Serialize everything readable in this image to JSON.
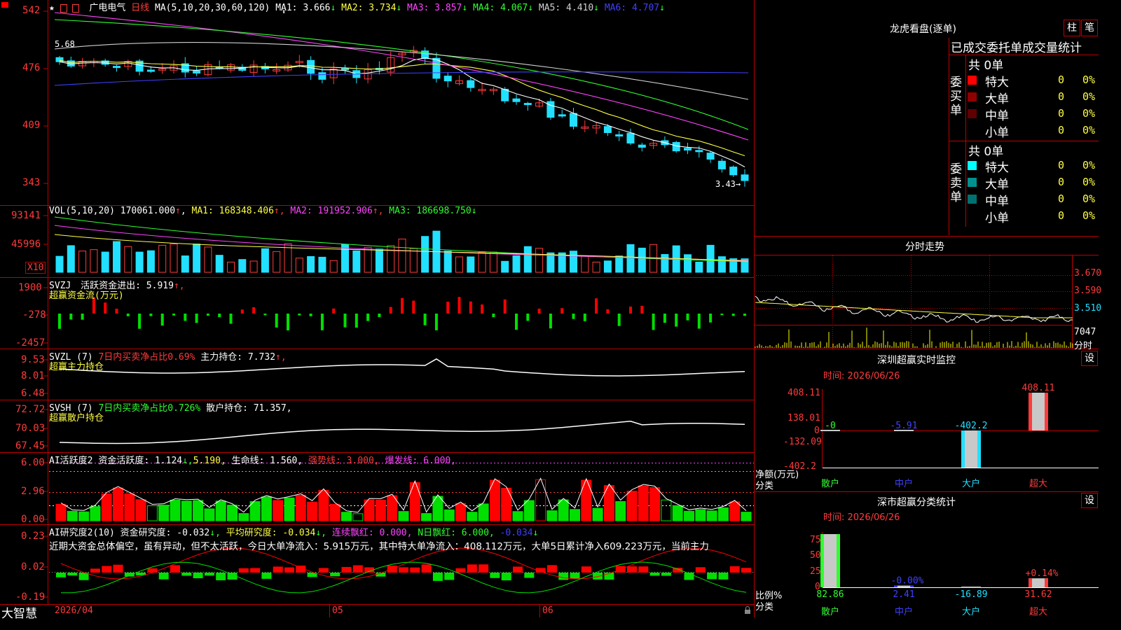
{
  "header": {
    "star_icon": "star-icon",
    "flag_icons": [
      "flag-icon",
      "flag-icon"
    ],
    "stock_name": "广电电气",
    "period": "日线",
    "ma_params": "MA(5,10,20,30,60,120)",
    "ma": [
      {
        "label": "MA1:",
        "value": "3.666",
        "arrow": "↓",
        "color": "#ffffff"
      },
      {
        "label": "MA2:",
        "value": "3.734",
        "arrow": "↓",
        "color": "#ffff44"
      },
      {
        "label": "MA3:",
        "value": "3.857",
        "arrow": "↓",
        "color": "#ff44ff"
      },
      {
        "label": "MA4:",
        "value": "4.067",
        "arrow": "↓",
        "color": "#30ff30"
      },
      {
        "label": "MA5:",
        "value": "4.410",
        "arrow": "↓",
        "color": "#d0d0d0"
      },
      {
        "label": "MA6:",
        "value": "4.707",
        "arrow": "↓",
        "color": "#4040ff"
      }
    ]
  },
  "price_axis": [
    "542",
    "476",
    "409",
    "343"
  ],
  "price_high_label": "5.68",
  "price_low_label": "3.43",
  "vol": {
    "title": "VOL(5,10,20)",
    "value": "170061.000",
    "ma": [
      {
        "label": "MA1:",
        "value": "168348.406",
        "arrow": "↑",
        "color": "#ffff44"
      },
      {
        "label": "MA2:",
        "value": "191952.906",
        "arrow": "↑",
        "color": "#ff44ff"
      },
      {
        "label": "MA3:",
        "value": "186698.750",
        "arrow": "↓",
        "color": "#30ff30"
      }
    ],
    "axis": [
      "93141",
      "45996"
    ],
    "unit": "X10"
  },
  "svzj": {
    "title": "SVZJ",
    "line1": "活跃资金进出: 5.919",
    "line1_arrow": "↑,",
    "line2": "超赢资金流(万元)",
    "axis": [
      "1900",
      "-278",
      "-2457"
    ]
  },
  "svzl": {
    "title": "SVZL (7)",
    "part1": "7日内买卖净占比0.69%",
    "part2": "主力持仓: 7.732",
    "part2_arrow": "↑,",
    "line2": "超赢主力持仓",
    "axis": [
      "9.53",
      "8.01",
      "6.48"
    ]
  },
  "svsh": {
    "title": "SVSH (7)",
    "part1": "7日内买卖净占比0.726%",
    "part2": "散户持仓: 71.357,",
    "line2": "超赢散户持仓",
    "axis": [
      "72.72",
      "70.03",
      "67.45"
    ]
  },
  "ai1": {
    "title": "AI活跃度2",
    "part1": "资金活跃度: 1.124",
    "part1_arrow": "↓,",
    "part2": "5.190,",
    "part3": "生命线: 1.560,",
    "part4": "强势线: 3.000,",
    "part5": "爆发线: 6.000,",
    "axis": [
      "6.00",
      "2.96",
      "0.00"
    ]
  },
  "ai2": {
    "title": "AI研究度2(10)",
    "part1": "资金研究度: -0.032",
    "part1_arrow": "↓,",
    "part2": "平均研究度: -0.034",
    "part2_arrow": "↓,",
    "part3": "连续飘红: 0.000,",
    "part4": "N日飘红: 6.000,",
    "part5": "-0.034",
    "part5_arrow": "↓",
    "comment": "近期大资金总体偏空，虽有异动，但不太活跃，今日大单净流入：5.915万元，其中特大单净流入：408.112万元，大单5日累计净入609.223万元，当前主力",
    "axis": [
      "0.23",
      "0.02",
      "-0.19"
    ]
  },
  "bottom": {
    "brand": "大智慧",
    "dates": [
      "2026/04",
      "05",
      "06"
    ],
    "lock_icon": "lock-icon"
  },
  "right": {
    "longhu_title": "龙虎看盘(逐单)",
    "btn_zhu": "柱",
    "btn_bi": "笔",
    "stat_title": "已成交委托单成交量统计",
    "buy_label": "委买单",
    "sell_label": "委卖单",
    "buy_total": "共 0单",
    "sell_total": "共 0单",
    "buy_rows": [
      {
        "name": "特大",
        "count": "0",
        "pct": "0%",
        "color": "#ff0000"
      },
      {
        "name": "大单",
        "count": "0",
        "pct": "0%",
        "color": "#900000"
      },
      {
        "name": "中单",
        "count": "0",
        "pct": "0%",
        "color": "#600000"
      },
      {
        "name": "小单",
        "count": "0",
        "pct": "0%",
        "color": ""
      }
    ],
    "sell_rows": [
      {
        "name": "特大",
        "count": "0",
        "pct": "0%",
        "color": "#00ffff"
      },
      {
        "name": "大单",
        "count": "0",
        "pct": "0%",
        "color": "#009090"
      },
      {
        "name": "中单",
        "count": "0",
        "pct": "0%",
        "color": "#007070"
      },
      {
        "name": "小单",
        "count": "0",
        "pct": "0%",
        "color": ""
      }
    ],
    "fenshi_title": "分时走势",
    "fenshi_axis": [
      "3.670",
      "3.590",
      "3.510"
    ],
    "fenshi_vol": "7047",
    "fenshi_vol_unit": "分时",
    "monitor_title": "深圳超赢实时监控",
    "monitor_btn": "设",
    "monitor_time": "时间: 2026/06/26",
    "monitor_axis": [
      "408.11",
      "138.01",
      "0",
      "-132.09",
      "-402.2"
    ],
    "monitor_unit": "净额(万元)",
    "monitor_cat_label": "分类",
    "classify_title": "深市超赢分类统计",
    "classify_btn": "设",
    "classify_time": "时间: 2026/06/26",
    "classify_axis": [
      "75",
      "50",
      "25",
      "0"
    ],
    "classify_unit": "比例%",
    "classify_cat_label": "分类"
  },
  "chart_data": [
    {
      "type": "bar",
      "title": "深圳超赢实时监控",
      "ylabel": "净额(万元)",
      "categories": [
        "散户",
        "中户",
        "大户",
        "超大"
      ],
      "values": [
        0,
        -5.91,
        -402.2,
        408.11
      ],
      "value_labels": [
        "-0",
        "-5.91",
        "-402.2",
        "408.11"
      ],
      "ylim": [
        -402.2,
        408.11
      ],
      "colors": [
        "#30ff30",
        "#4040ff",
        "#22e0ff",
        "#ff3b3b"
      ]
    },
    {
      "type": "bar",
      "title": "深市超赢分类统计",
      "ylabel": "比例%",
      "categories": [
        "散户",
        "中户",
        "大户",
        "超大"
      ],
      "values": [
        82.86,
        2.41,
        -16.89,
        31.62
      ],
      "value_labels": [
        "82.86",
        "2.41",
        "-16.89",
        "31.62"
      ],
      "bar_labels": [
        "",
        "-0.00%",
        "",
        "+0.14%"
      ],
      "ylim": [
        0,
        75
      ],
      "colors": [
        "#30ff30",
        "#4040ff",
        "#22e0ff",
        "#ff3b3b"
      ]
    }
  ]
}
